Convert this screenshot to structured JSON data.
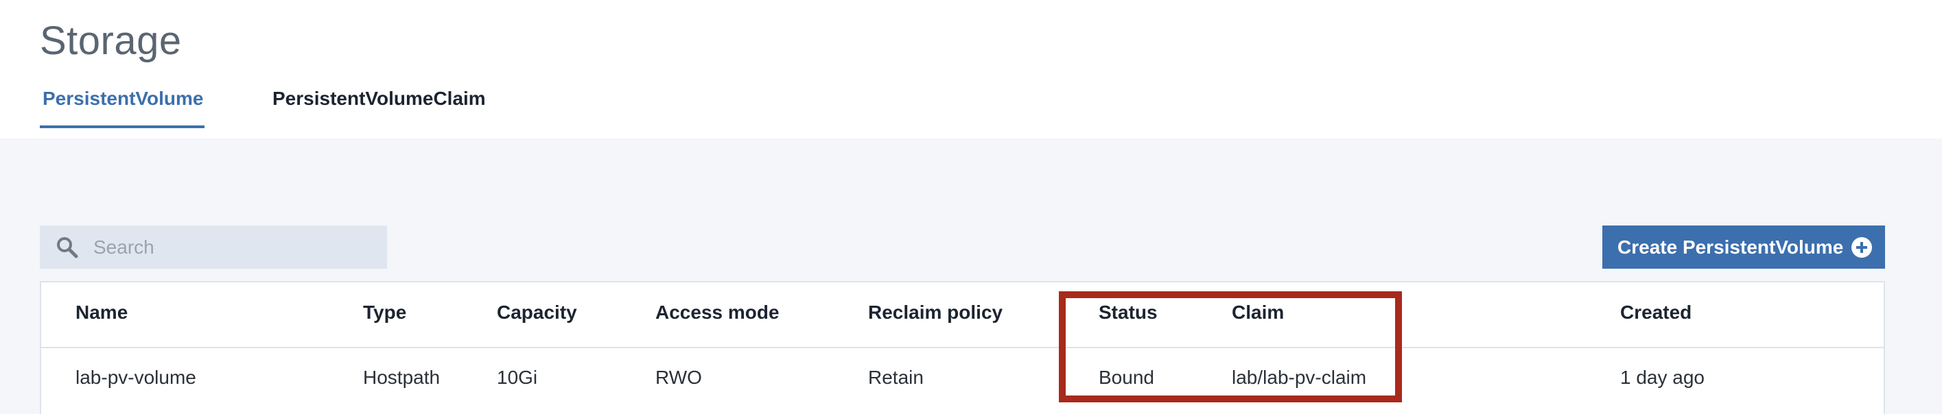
{
  "page": {
    "title": "Storage"
  },
  "tabs": [
    {
      "label": "PersistentVolume",
      "active": true
    },
    {
      "label": "PersistentVolumeClaim",
      "active": false
    }
  ],
  "search": {
    "placeholder": "Search",
    "value": "",
    "icon": "search-icon"
  },
  "toolbar": {
    "create_label": "Create PersistentVolume",
    "create_icon": "plus-circle-icon"
  },
  "table": {
    "headers": {
      "name": "Name",
      "type": "Type",
      "capacity": "Capacity",
      "access_mode": "Access mode",
      "reclaim_policy": "Reclaim policy",
      "status": "Status",
      "claim": "Claim",
      "created": "Created"
    },
    "rows": [
      {
        "name": "lab-pv-volume",
        "type": "Hostpath",
        "capacity": "10Gi",
        "access_mode": "RWO",
        "reclaim_policy": "Retain",
        "status": "Bound",
        "claim": "lab/lab-pv-claim",
        "created": "1 day ago"
      }
    ]
  },
  "colors": {
    "accent": "#3c6fad",
    "highlight": "#a82a1c",
    "background": "#f4f6fa",
    "search_bg": "#dfe6ef"
  }
}
